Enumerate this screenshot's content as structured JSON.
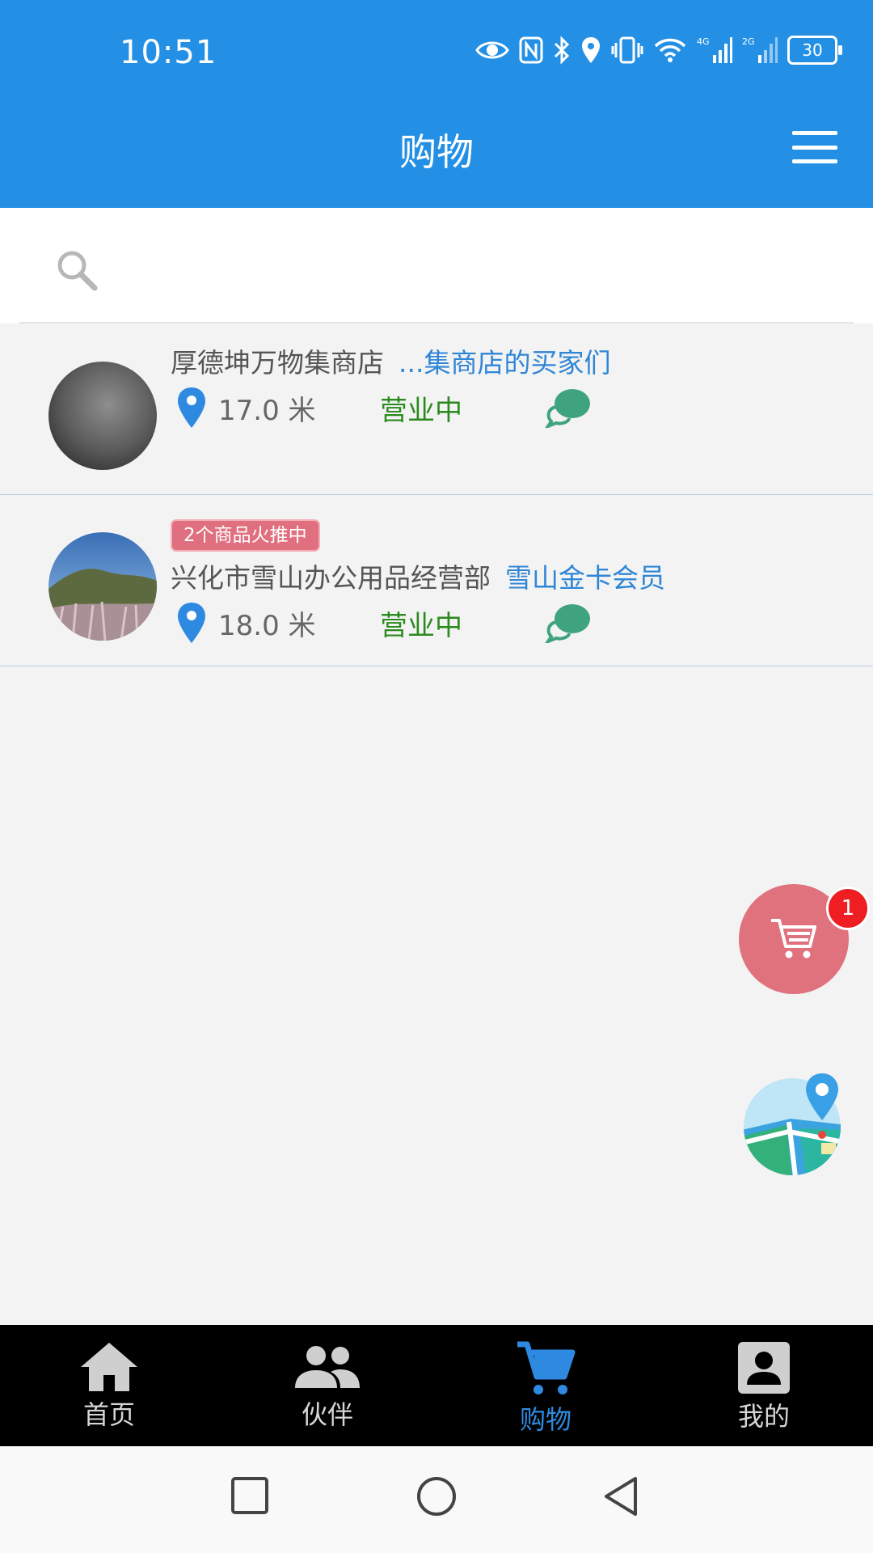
{
  "status_bar": {
    "time": "10:51",
    "battery": "30",
    "network_1": "4G",
    "network_2": "2G"
  },
  "header": {
    "title": "购物",
    "menu_icon": "hamburger-menu-icon"
  },
  "search": {
    "placeholder": "",
    "value": ""
  },
  "stores": [
    {
      "name": "厚德坤万物集商店",
      "link": "...集商店的买家们",
      "distance": "17.0 米",
      "status": "营业中",
      "promo": ""
    },
    {
      "name": "兴化市雪山办公用品经营部",
      "link": "雪山金卡会员",
      "distance": "18.0 米",
      "status": "营业中",
      "promo": "2个商品火推中"
    }
  ],
  "cart": {
    "count": "1"
  },
  "bottom_nav": {
    "items": [
      {
        "label": "首页",
        "icon": "home-icon"
      },
      {
        "label": "伙伴",
        "icon": "people-icon"
      },
      {
        "label": "购物",
        "icon": "cart-icon",
        "active": true
      },
      {
        "label": "我的",
        "icon": "profile-icon"
      }
    ]
  },
  "colors": {
    "header": "#2490e5",
    "accent": "#2e8ae0",
    "open_status": "#2b8a1d",
    "cart_fab": "#e0727e",
    "badge": "#ee1e23"
  }
}
